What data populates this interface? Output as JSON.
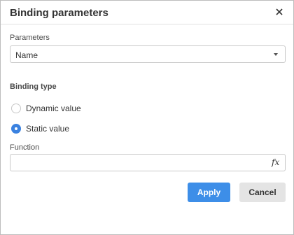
{
  "dialog": {
    "title": "Binding parameters",
    "close_icon": "close-icon"
  },
  "parameters": {
    "label": "Parameters",
    "selected": "Name"
  },
  "binding_type": {
    "label": "Binding type",
    "options": [
      {
        "label": "Dynamic value",
        "checked": false
      },
      {
        "label": "Static value",
        "checked": true
      }
    ]
  },
  "function": {
    "label": "Function",
    "value": "",
    "fx_icon": "fx"
  },
  "buttons": {
    "apply": "Apply",
    "cancel": "Cancel"
  },
  "colors": {
    "accent": "#3d8ee8",
    "cancel_bg": "#e4e4e4"
  }
}
